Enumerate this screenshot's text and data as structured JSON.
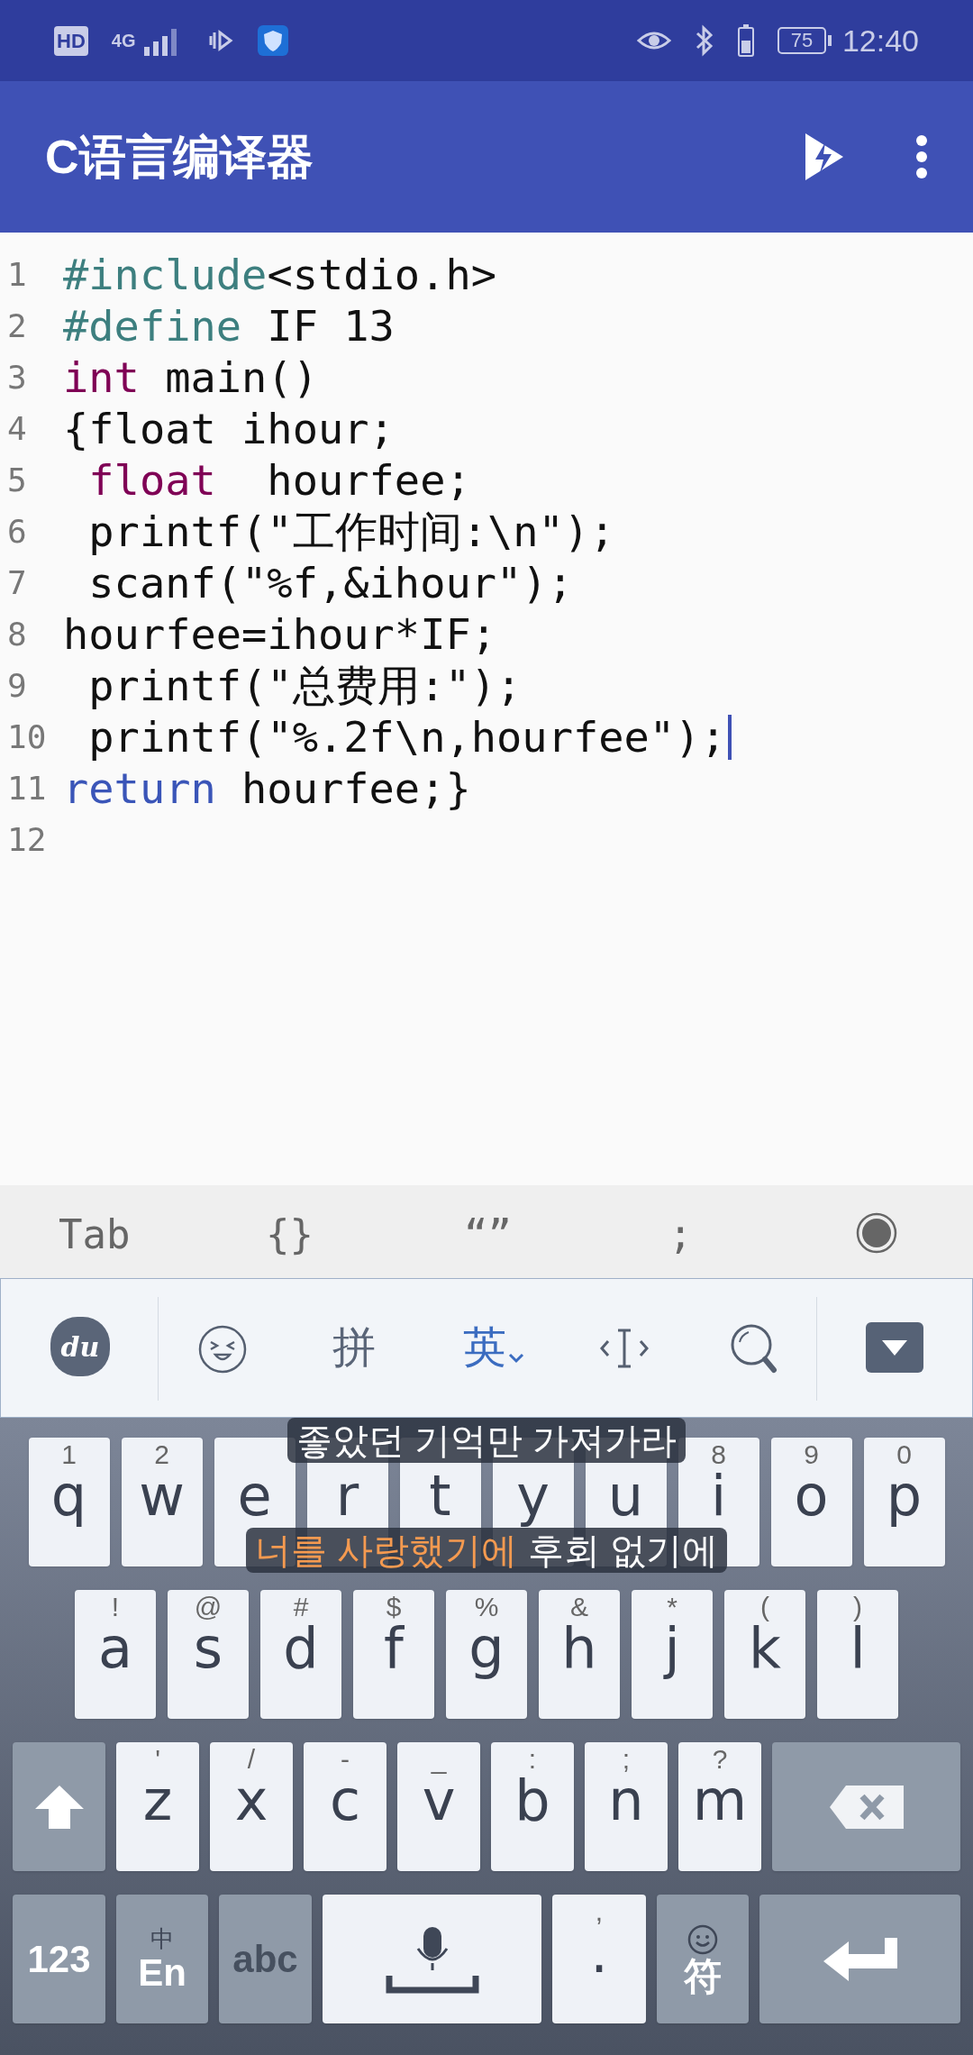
{
  "status_bar": {
    "left_badges": [
      "HD",
      "4G"
    ],
    "battery": "75",
    "time": "12:40"
  },
  "app_bar": {
    "title": "C语言编译器"
  },
  "editor": {
    "lines": [
      {
        "number": "1",
        "cursor": false,
        "tokens": [
          {
            "text": "#include",
            "kind": "preprocessor"
          },
          {
            "text": "<stdio.h>",
            "kind": "plain"
          }
        ]
      },
      {
        "number": "2",
        "cursor": false,
        "tokens": [
          {
            "text": "#define",
            "kind": "preprocessor"
          },
          {
            "text": " IF 13",
            "kind": "plain"
          }
        ]
      },
      {
        "number": "3",
        "cursor": false,
        "tokens": [
          {
            "text": "int",
            "kind": "type"
          },
          {
            "text": " main()",
            "kind": "plain"
          }
        ]
      },
      {
        "number": "4",
        "cursor": false,
        "tokens": [
          {
            "text": "{float ihour;",
            "kind": "plain"
          }
        ]
      },
      {
        "number": "5",
        "cursor": false,
        "tokens": [
          {
            "text": " float",
            "kind": "type"
          },
          {
            "text": "  hourfee;",
            "kind": "plain"
          }
        ]
      },
      {
        "number": "6",
        "cursor": false,
        "tokens": [
          {
            "text": " printf(\"工作时间:\\n\");",
            "kind": "plain"
          }
        ]
      },
      {
        "number": "7",
        "cursor": false,
        "tokens": [
          {
            "text": " scanf(\"%f,&ihour\");",
            "kind": "plain"
          }
        ]
      },
      {
        "number": "8",
        "cursor": false,
        "tokens": [
          {
            "text": "hourfee=ihour*IF;",
            "kind": "plain"
          }
        ]
      },
      {
        "number": "9",
        "cursor": false,
        "tokens": [
          {
            "text": " printf(\"总费用:\");",
            "kind": "plain"
          }
        ]
      },
      {
        "number": "10",
        "cursor": true,
        "tokens": [
          {
            "text": " printf(\"%.2f\\n,hourfee\");",
            "kind": "plain"
          }
        ]
      },
      {
        "number": "11",
        "cursor": false,
        "tokens": [
          {
            "text": "return",
            "kind": "keyword"
          },
          {
            "text": " hourfee;}",
            "kind": "plain"
          }
        ]
      },
      {
        "number": "12",
        "cursor": false
      }
    ]
  },
  "quick_keys": [
    "Tab",
    "{}",
    "“”",
    ";"
  ],
  "ime_toolbar": [
    {
      "kind": "logo",
      "label": "du"
    },
    {
      "kind": "emoji"
    },
    {
      "kind": "text",
      "label": "拼",
      "selected": false
    },
    {
      "kind": "text",
      "label": "英",
      "selected": true
    },
    {
      "kind": "cursor"
    },
    {
      "kind": "search"
    }
  ],
  "keyboard": {
    "rows": [
      {
        "keys": [
          {
            "kind": "letter",
            "label": "q",
            "hint": "1"
          },
          {
            "kind": "letter",
            "label": "w",
            "hint": "2"
          },
          {
            "kind": "letter",
            "label": "e"
          },
          {
            "kind": "letter",
            "label": "r"
          },
          {
            "kind": "letter",
            "label": "t"
          },
          {
            "kind": "letter",
            "label": "y"
          },
          {
            "kind": "letter",
            "label": "u"
          },
          {
            "kind": "letter",
            "label": "i",
            "hint": "8"
          },
          {
            "kind": "letter",
            "label": "o",
            "hint": "9"
          },
          {
            "kind": "letter",
            "label": "p",
            "hint": "0"
          }
        ]
      },
      {
        "keys": [
          {
            "kind": "letter",
            "label": "a",
            "hint": "!"
          },
          {
            "kind": "letter",
            "label": "s",
            "hint": "@"
          },
          {
            "kind": "letter",
            "label": "d",
            "hint": "#"
          },
          {
            "kind": "letter",
            "label": "f",
            "hint": "$"
          },
          {
            "kind": "letter",
            "label": "g",
            "hint": "%"
          },
          {
            "kind": "letter",
            "label": "h",
            "hint": "&"
          },
          {
            "kind": "letter",
            "label": "j",
            "hint": "*"
          },
          {
            "kind": "letter",
            "label": "k",
            "hint": "("
          },
          {
            "kind": "letter",
            "label": "l",
            "hint": ")"
          }
        ]
      },
      {
        "keys": [
          {
            "kind": "shift"
          },
          {
            "kind": "letter",
            "label": "z",
            "hint": "'"
          },
          {
            "kind": "letter",
            "label": "x",
            "hint": "/"
          },
          {
            "kind": "letter",
            "label": "c",
            "hint": "-"
          },
          {
            "kind": "letter",
            "label": "v",
            "hint": "_"
          },
          {
            "kind": "letter",
            "label": "b",
            "hint": ":"
          },
          {
            "kind": "letter",
            "label": "n",
            "hint": ";"
          },
          {
            "kind": "letter",
            "label": "m",
            "hint": "?"
          },
          {
            "kind": "backspace"
          }
        ]
      },
      {
        "keys": [
          {
            "kind": "function",
            "label": "123"
          },
          {
            "kind": "function",
            "label": "En",
            "hint": "中"
          },
          {
            "kind": "function_dark",
            "label": "abc"
          },
          {
            "kind": "space"
          },
          {
            "kind": "letter",
            "label": ".",
            "hint": ","
          },
          {
            "kind": "function",
            "label": "符",
            "emoji_hint": true
          },
          {
            "kind": "enter"
          }
        ]
      }
    ]
  },
  "lyrics": [
    [
      {
        "text": "좋았던 기억만 가져가라",
        "highlighted": false
      }
    ],
    [
      {
        "text": "너를 사랑했기에",
        "highlighted": true
      },
      {
        "text": " 후회 없기에",
        "highlighted": false
      }
    ]
  ]
}
